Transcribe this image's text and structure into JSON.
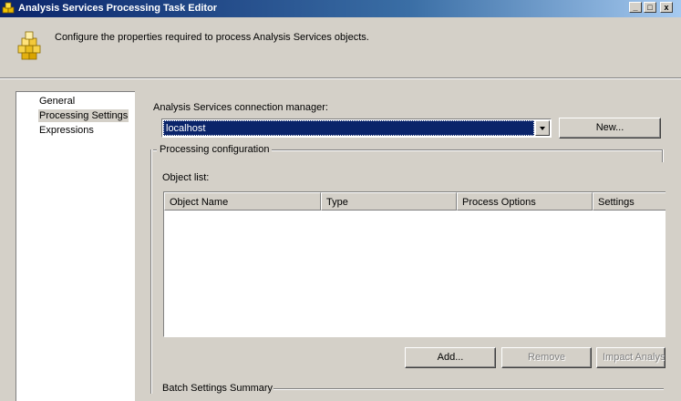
{
  "window": {
    "title": "Analysis Services Processing Task Editor",
    "controls": {
      "minimize": "_",
      "maximize": "□",
      "close": "x"
    }
  },
  "header": {
    "description": "Configure the properties required to process Analysis Services objects.",
    "icon": "cubes-icon"
  },
  "nav": {
    "items": [
      {
        "label": "General",
        "selected": false
      },
      {
        "label": "Processing Settings",
        "selected": true
      },
      {
        "label": "Expressions",
        "selected": false
      }
    ]
  },
  "connection": {
    "label": "Analysis Services connection manager:",
    "value": "localhost",
    "new_button": "New..."
  },
  "processing": {
    "group_label": "Processing configuration",
    "object_list_label": "Object list:",
    "columns": [
      "Object Name",
      "Type",
      "Process Options",
      "Settings"
    ],
    "rows": [],
    "buttons": {
      "add": "Add...",
      "remove": "Remove",
      "impact": "Impact Analysis"
    }
  },
  "batch": {
    "label": "Batch Settings Summary"
  },
  "colors": {
    "titlebar_start": "#0a246a",
    "titlebar_end": "#a6caf0",
    "face": "#d4d0c8",
    "selection": "#0a246a"
  }
}
